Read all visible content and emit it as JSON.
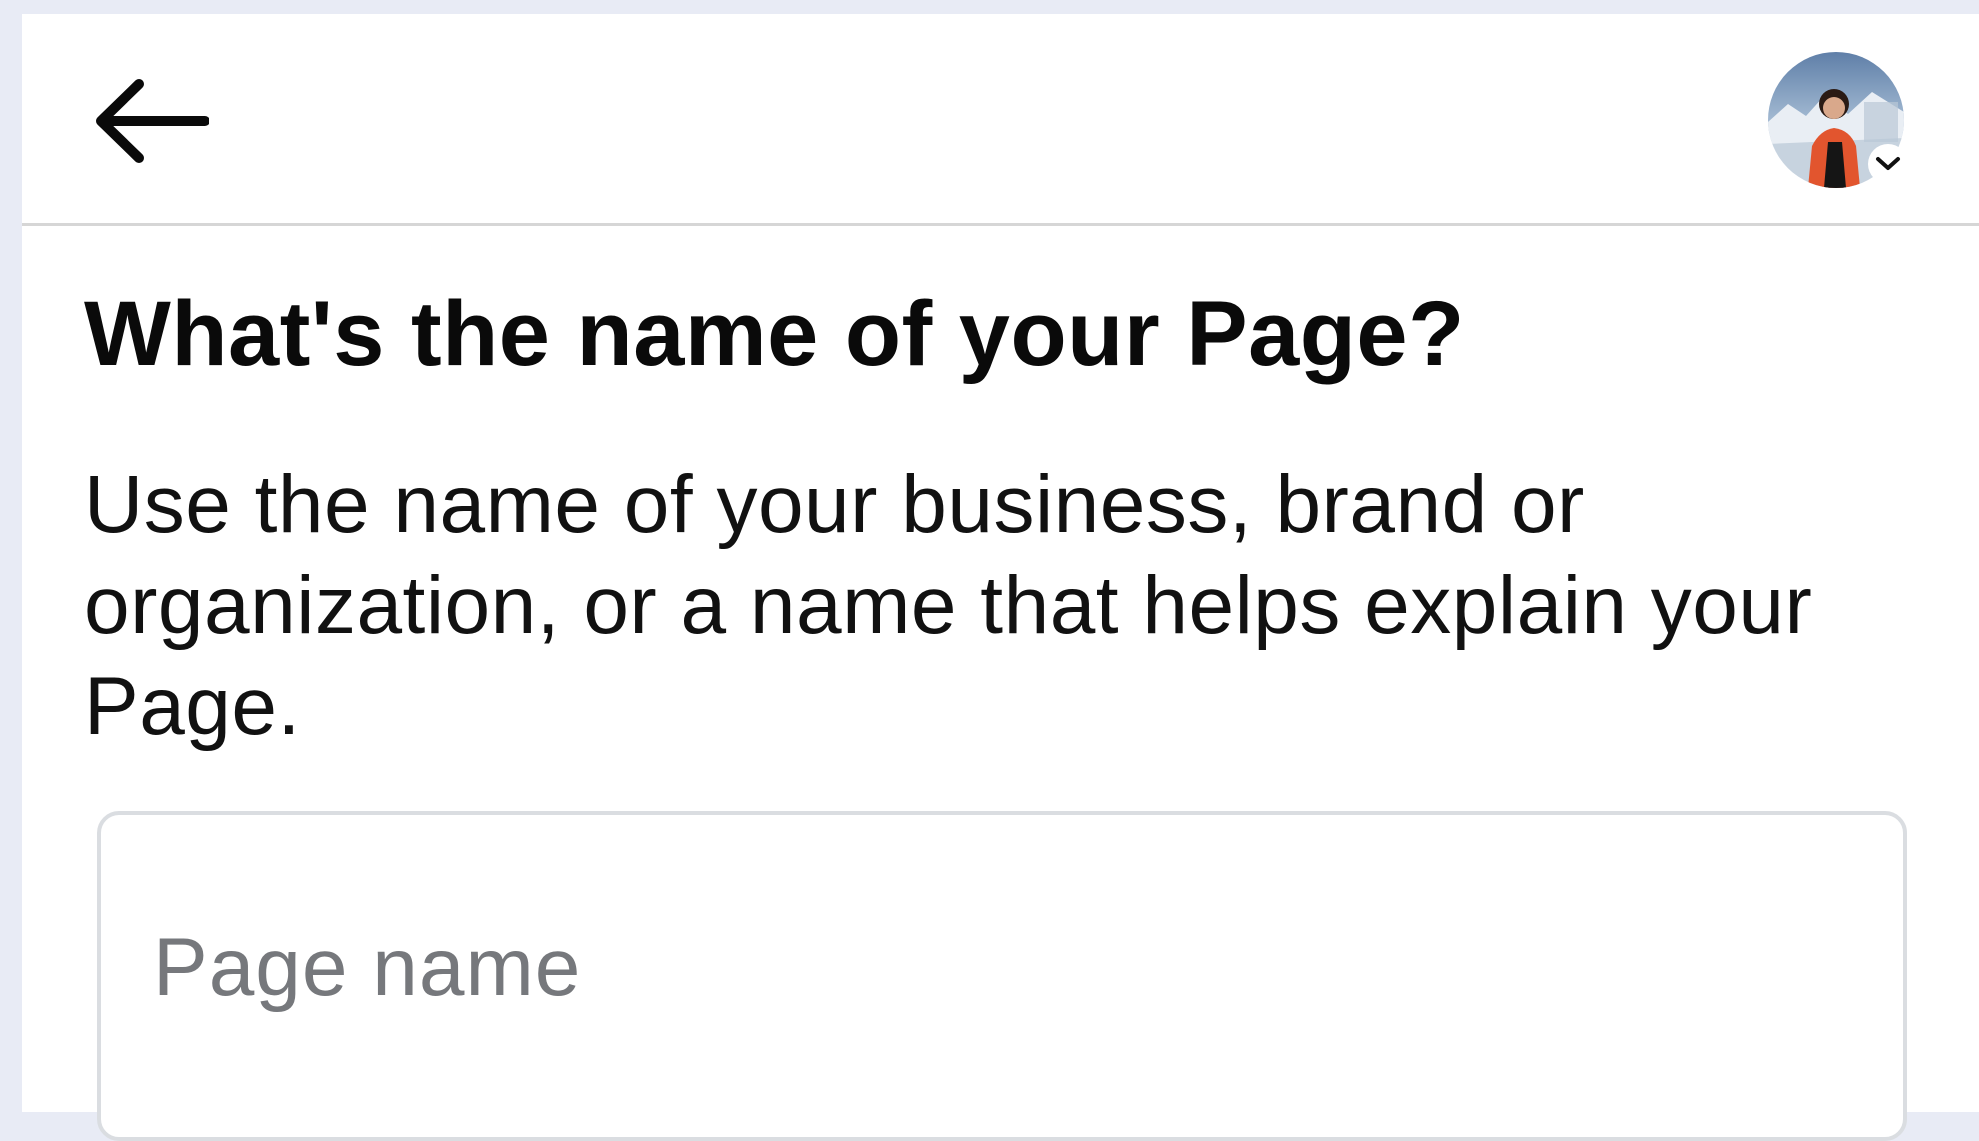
{
  "header": {
    "back_icon": "arrow-left-icon",
    "avatar_icon": "profile-avatar",
    "avatar_menu_icon": "chevron-down-icon"
  },
  "main": {
    "title": "What's the name of your Page?",
    "description": "Use the name of your business, brand or organization, or a name that helps explain your Page.",
    "page_name_field": {
      "placeholder": "Page name",
      "value": ""
    }
  },
  "colors": {
    "background": "#e8ebf5",
    "panel": "#ffffff",
    "divider": "#d6d6d6",
    "input_border": "#dadde1",
    "placeholder": "#76787c"
  }
}
